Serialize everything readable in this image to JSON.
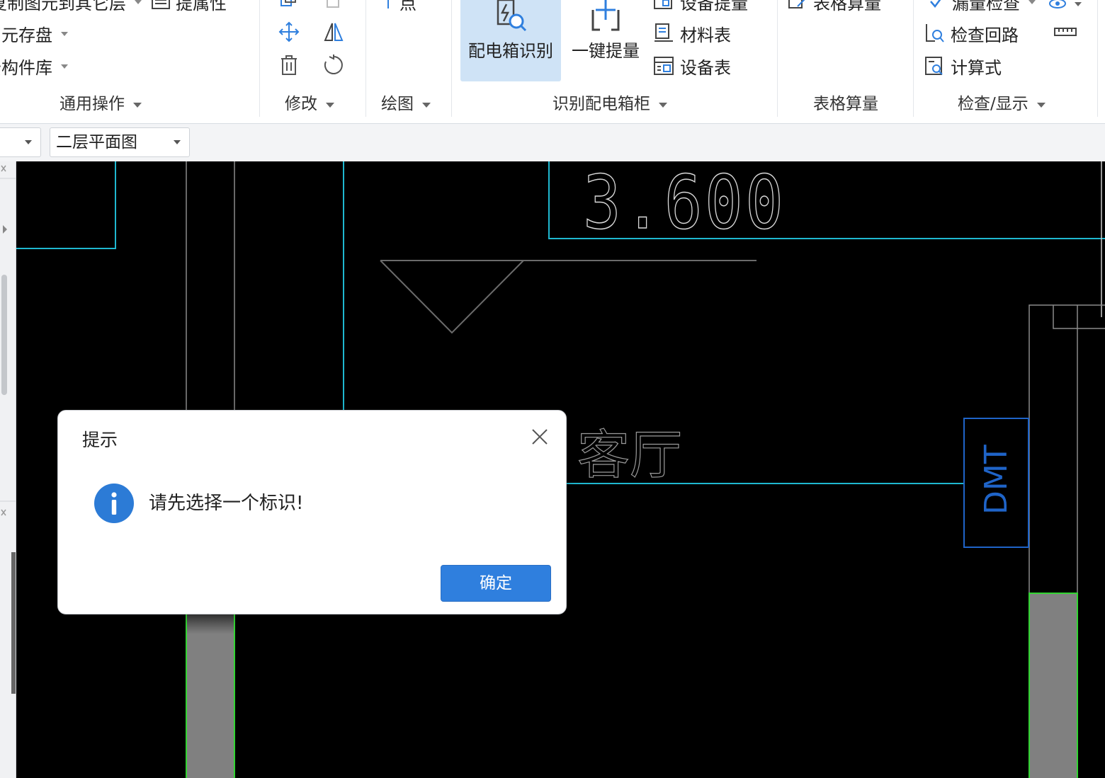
{
  "ribbon": {
    "general_ops": {
      "group_label": "通用操作",
      "items": [
        {
          "label": "复制图元到其它层"
        },
        {
          "label": "图元存盘"
        },
        {
          "label": "云构件库"
        }
      ],
      "extract_layer_label": "提属性"
    },
    "modify": {
      "group_label": "修改"
    },
    "draw": {
      "group_label": "绘图",
      "point_label": "点"
    },
    "distribution_box": {
      "group_label": "识别配电箱柜",
      "box_recognize_label": "配电箱识别",
      "one_key_label": "一键提量",
      "equipment_extract_label": "设备提量",
      "material_table_label": "材料表",
      "equipment_table_label": "设备表"
    },
    "table_calc": {
      "group_label": "表格算量",
      "table_calc_label": "表格算量"
    },
    "check_display": {
      "group_label": "检查/显示",
      "missing_check_label": "漏量检查",
      "check_loop_label": "检查回路",
      "formula_label": "计算式"
    }
  },
  "toolbar": {
    "floor_plan_select": "二层平面图"
  },
  "canvas": {
    "elevation_text": "3.600",
    "room_label": "客厅",
    "box_label": "DMT"
  },
  "dialog": {
    "title": "提示",
    "message": "请先选择一个标识!",
    "ok_label": "确定"
  },
  "colors": {
    "accent": "#2f7fde",
    "cyan_line": "#1fb8d0",
    "green_line": "#32d432",
    "blue_box": "#1f64c8"
  }
}
